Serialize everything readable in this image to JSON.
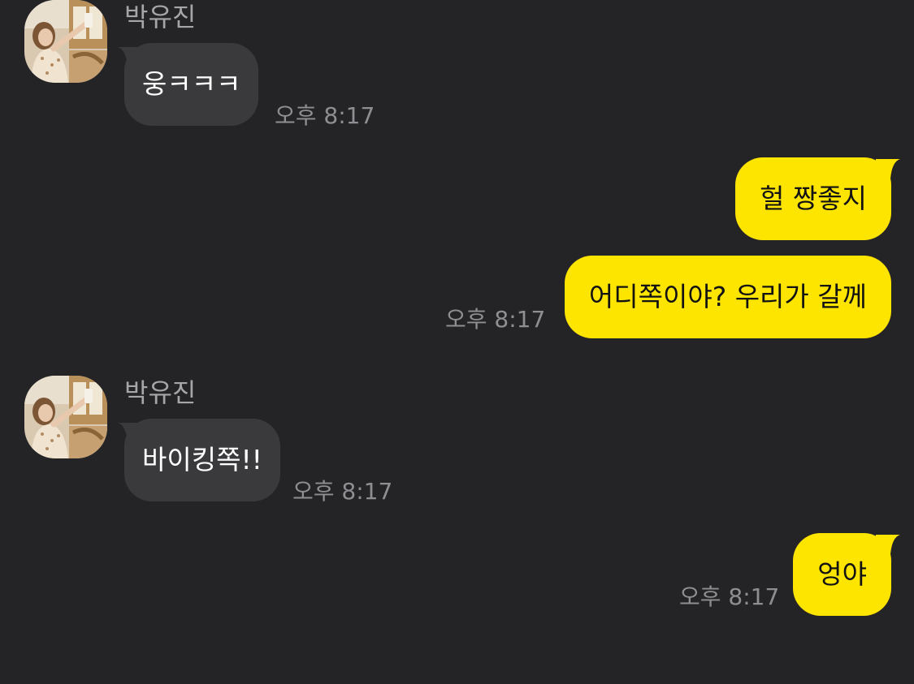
{
  "chat": {
    "colors": {
      "background": "#242427",
      "incoming_bubble": "#3a3a3c",
      "outgoing_bubble": "#fee500",
      "name_text": "#a6a6a9",
      "time_text": "#8f8f93"
    },
    "messages": [
      {
        "direction": "incoming",
        "sender": "박유진",
        "avatar": "profile-photo",
        "text": "웅ㅋㅋㅋ",
        "time": "오후 8:17"
      },
      {
        "direction": "outgoing",
        "text": "헐 짱좋지",
        "time": ""
      },
      {
        "direction": "outgoing",
        "text": "어디쪽이야? 우리가 갈께",
        "time": "오후 8:17"
      },
      {
        "direction": "incoming",
        "sender": "박유진",
        "avatar": "profile-photo",
        "text": "바이킹쪽!!",
        "time": "오후 8:17"
      },
      {
        "direction": "outgoing",
        "text": "엉야",
        "time": "오후 8:17"
      }
    ]
  }
}
